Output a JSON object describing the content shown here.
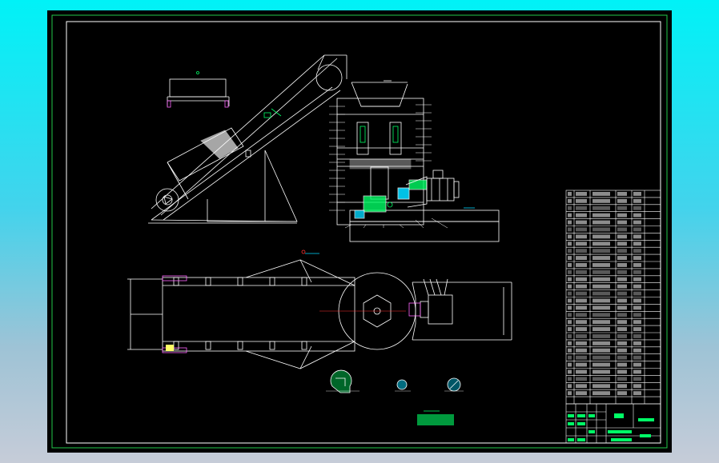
{
  "drawing": {
    "background": "#000000",
    "line_color": "#ffffff",
    "frame_color": "#22c94a",
    "accent_green": "#00ff66",
    "accent_cyan": "#00d8ff",
    "accent_red": "#ff3333",
    "accent_magenta": "#ff66ff"
  },
  "title_block": {
    "name_cell": "",
    "drawing_no": ""
  },
  "parts_list": {
    "rows": 30
  }
}
